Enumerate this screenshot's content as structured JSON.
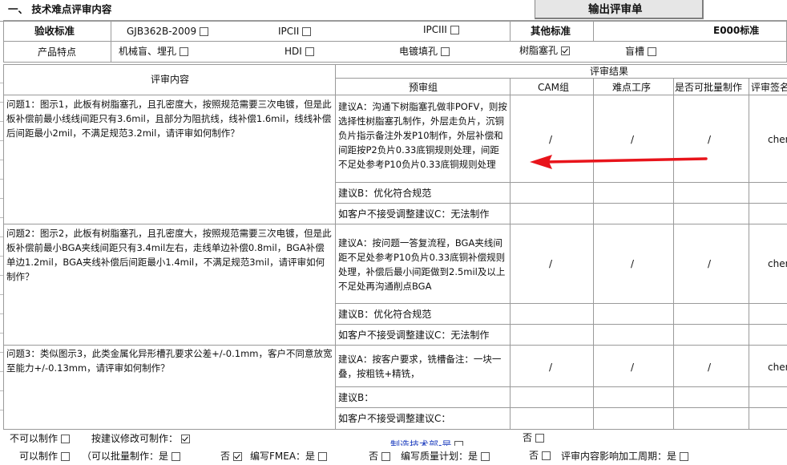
{
  "section_title": "一、 技术难点评审内容",
  "output_button": "输出评审单",
  "acceptance": {
    "label": "验收标准",
    "options": [
      {
        "label": "GJB362B-2009",
        "checked": false
      },
      {
        "label": "IPCII",
        "checked": false
      },
      {
        "label": "IPCIII",
        "checked": false
      }
    ],
    "other_label": "其他标准",
    "other_value": "E000标准"
  },
  "features": {
    "label": "产品特点",
    "options": [
      {
        "label": "机械盲、埋孔",
        "checked": false
      },
      {
        "label": "HDI",
        "checked": false
      },
      {
        "label": "电镀填孔",
        "checked": false
      },
      {
        "label": "树脂塞孔",
        "checked": true
      },
      {
        "label": "盲槽",
        "checked": false
      }
    ]
  },
  "table": {
    "review_content_header": "评审内容",
    "review_result_header": "评审结果",
    "columns": [
      "预审组",
      "CAM组",
      "难点工序",
      "是否可批量制作",
      "评审签名"
    ],
    "questions": [
      {
        "question": "问题1：图示1，此板有树脂塞孔，且孔密度大，按照规范需要三次电镀，但是此板补偿前最小线线间距只有3.6mil，且部分为阻抗线，线补偿1.6mil，线线补偿后间距最小2mil，不满足规范3.2mil，请评审如何制作？",
        "suggestions": [
          {
            "text": "建议A：沟通下树脂塞孔做非POFV，则按选择性树脂塞孔制作，外层走负片，沉铜负片指示备注外发P10制作，外层补偿和间距按P2负片0.33底铜规则处理，间距不足处参考P10负片0.33底铜规则处理",
            "cam": "/",
            "process": "/",
            "batch": "/",
            "sign": "chen"
          },
          {
            "text": "建议B：优化符合规范",
            "cam": "",
            "process": "",
            "batch": "",
            "sign": ""
          },
          {
            "text": "如客户不接受调整建议C：无法制作",
            "cam": "",
            "process": "",
            "batch": "",
            "sign": ""
          }
        ]
      },
      {
        "question": "问题2：图示2，此板有树脂塞孔，且孔密度大，按照规范需要三次电镀，但是此板补偿前最小BGA夹线间距只有3.4mil左右，走线单边补偿0.8mil，BGA补偿单边1.2mil，BGA夹线补偿后间距最小1.4mil，不满足规范3mil，请评审如何制作？",
        "suggestions": [
          {
            "text": "建议A：按问题一答复流程，BGA夹线间距不足处参考P10负片0.33底铜补偿规则处理，补偿后最小间距做到2.5mil及以上不足处再沟通削点BGA",
            "cam": "/",
            "process": "/",
            "batch": "/",
            "sign": "chen"
          },
          {
            "text": "建议B：优化符合规范",
            "cam": "",
            "process": "",
            "batch": "",
            "sign": ""
          },
          {
            "text": "如客户不接受调整建议C：无法制作",
            "cam": "",
            "process": "",
            "batch": "",
            "sign": ""
          }
        ]
      },
      {
        "question": "问题3：类似图示3，此类金属化异形槽孔要求公差+/-0.1mm，客户不同意放宽至能力+/-0.13mm，请评审如何制作？",
        "suggestions": [
          {
            "text": "建议A：按客户要求，铣槽备注：一块一叠，按粗铣+精铣，",
            "cam": "/",
            "process": "/",
            "batch": "/",
            "sign": "chen"
          },
          {
            "text": "建议B：",
            "cam": "",
            "process": "",
            "batch": "",
            "sign": ""
          },
          {
            "text": "如客户不接受调整建议C：",
            "cam": "",
            "process": "",
            "batch": "",
            "sign": ""
          }
        ]
      }
    ]
  },
  "footer": {
    "cannot_make": {
      "label": "不可以制作",
      "checked": false
    },
    "modify_make": {
      "label": "按建议修改可制作：",
      "checked": true
    },
    "no_top": {
      "label": "否",
      "checked": false
    },
    "dept_link": "制造技术部-是",
    "can_make": {
      "label": "可以制作",
      "checked": false
    },
    "batch_note": "（可以批量制作：是",
    "no1": {
      "label": "否",
      "checked": true
    },
    "fmea": "编写FMEA：是",
    "no2": {
      "label": "否",
      "checked": false
    },
    "quality_plan": "编写质量计划：是",
    "no3": {
      "label": "否",
      "checked": false
    },
    "cycle": "评审内容影响加工周期：是"
  },
  "colors": {
    "grid": "#9a9a9a",
    "arrow": "#e8141b",
    "link": "#1f3fbf",
    "button_bg": "#e6e6e6"
  }
}
